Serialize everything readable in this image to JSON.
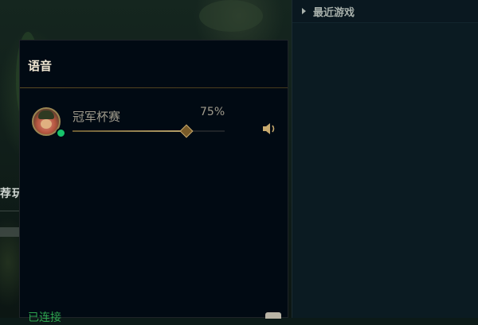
{
  "background": {
    "partial_label": "荐玩"
  },
  "right_panel": {
    "recent_games_label": "最近游戏"
  },
  "voice_panel": {
    "title": "语音",
    "member": {
      "name": "冠军杯赛",
      "volume_text": "75%",
      "volume": 0.75,
      "status": "online",
      "status_color": "#17c36b"
    },
    "speaker_icon": "speaker-icon",
    "connection_status": "已连接",
    "accent_color": "#c8aa6e"
  }
}
